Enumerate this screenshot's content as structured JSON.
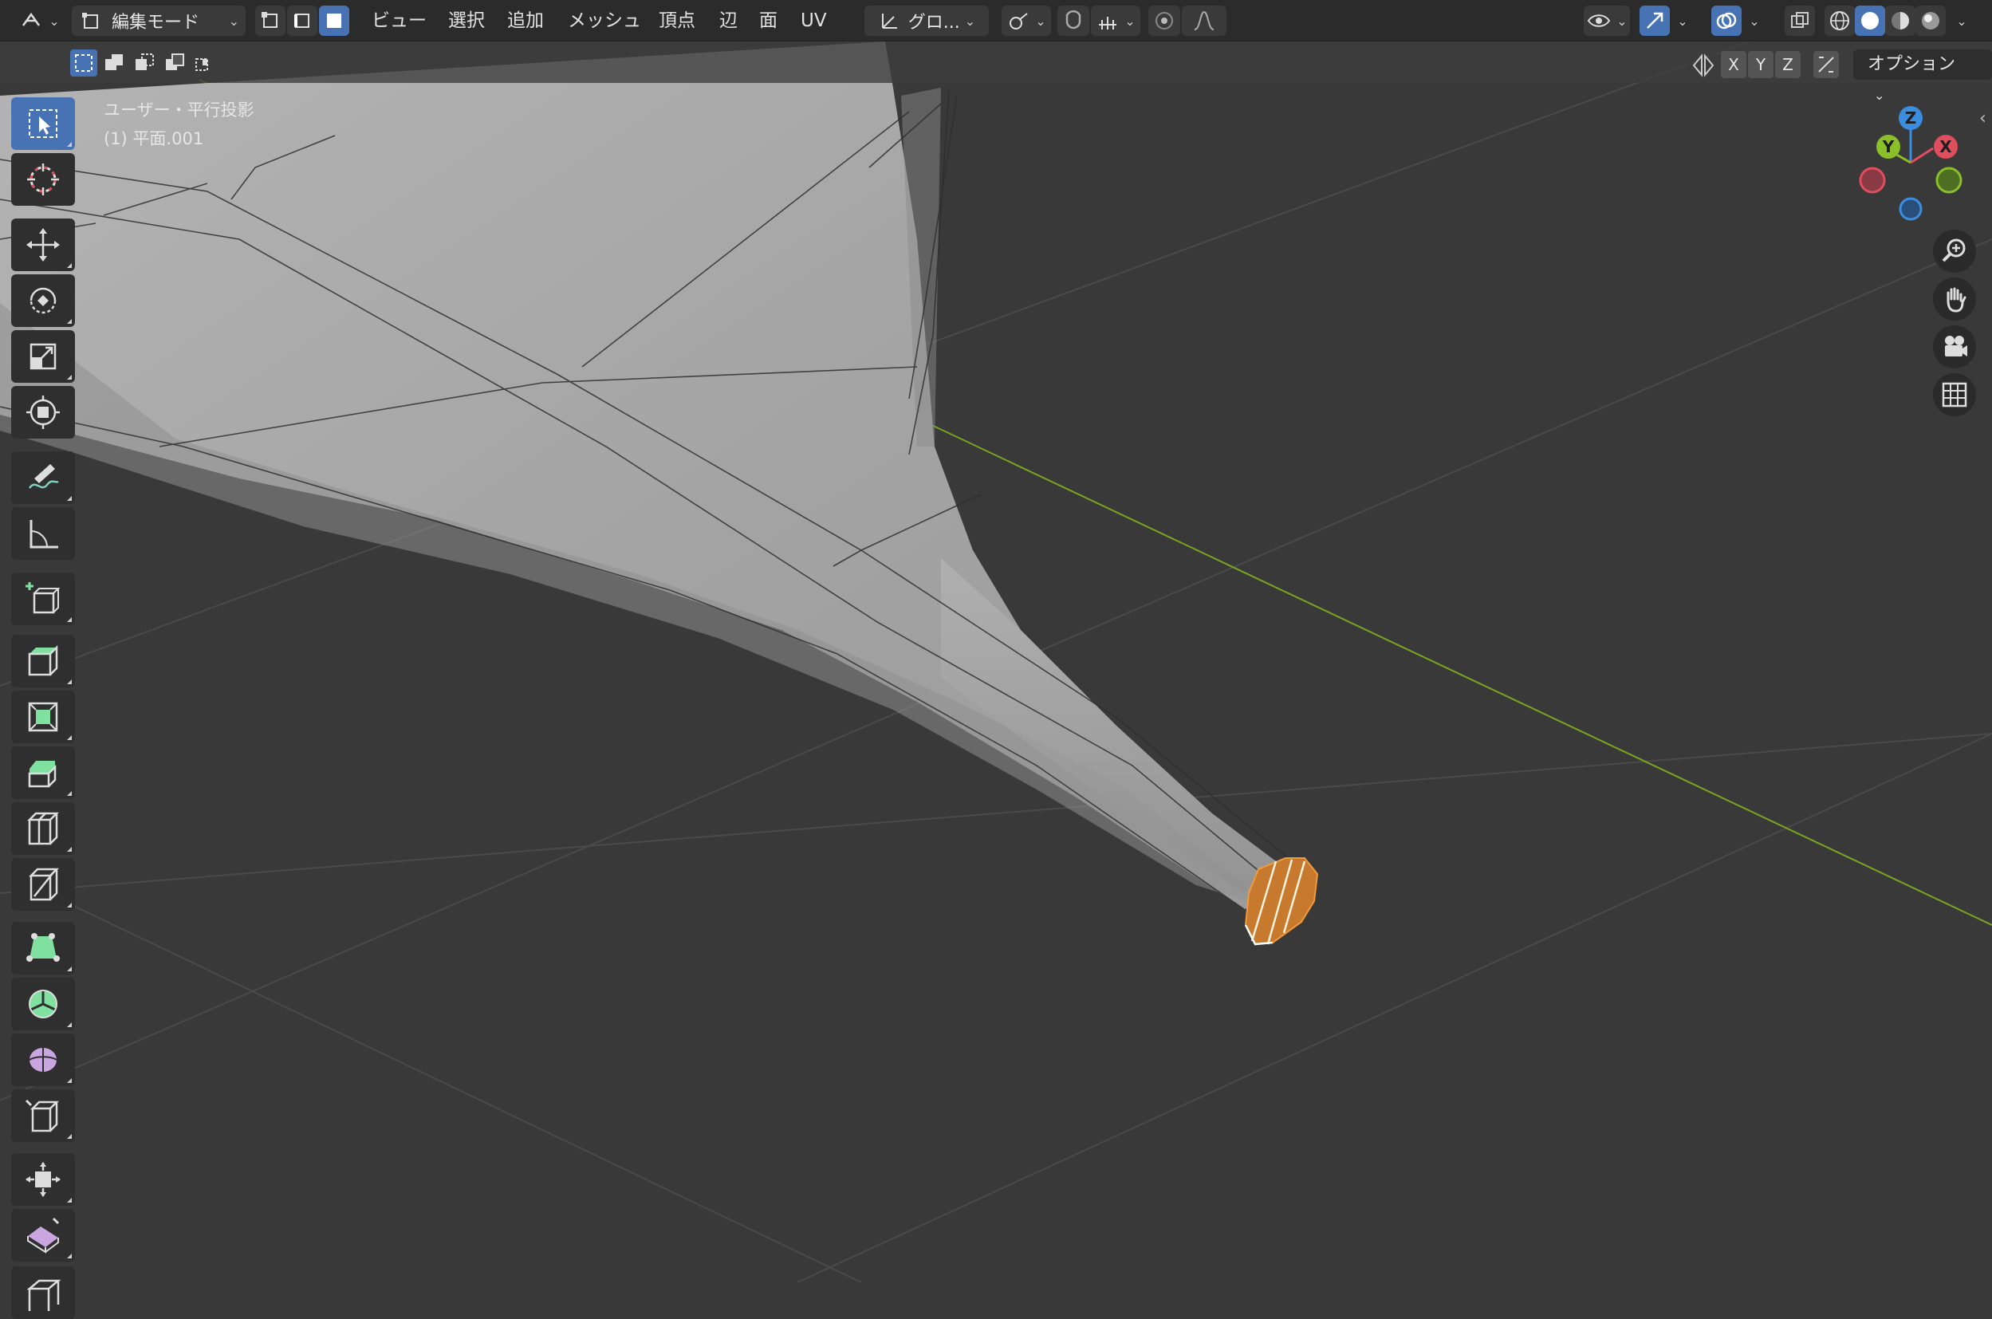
{
  "window": {
    "mode_label": "編集モード"
  },
  "menu": {
    "items": [
      "ビュー",
      "選択",
      "追加",
      "メッシュ",
      "頂点",
      "辺",
      "面",
      "UV"
    ]
  },
  "transform": {
    "orientation_label": "グロ..."
  },
  "viewport": {
    "view_name": "ユーザー・平行投影",
    "object_name": "(1) 平面.001"
  },
  "mirror_axes": [
    "X",
    "Y",
    "Z"
  ],
  "options_label": "オプション",
  "gizmo": {
    "x_label": "X",
    "y_label": "Y",
    "z_label": "Z"
  },
  "colors": {
    "accent": "#4772b3",
    "header_bg": "#2b2b2b",
    "viewport_bg": "#393939",
    "mesh": "#a9a9a9",
    "selection": "#e08a32",
    "grid_y_axis": "#7aa521",
    "axis_x": "#e04e5e",
    "axis_y": "#8bbf2a",
    "axis_z": "#3b8de0"
  },
  "toolbar": {
    "tools": [
      "select-box-icon",
      "cursor-icon",
      "move-icon",
      "rotate-icon",
      "scale-icon",
      "transform-icon",
      "annotate-icon",
      "measure-icon",
      "add-cube-icon",
      "extrude-region-icon",
      "inset-faces-icon",
      "bevel-icon",
      "loop-cut-icon",
      "knife-icon",
      "poly-build-icon",
      "spin-icon",
      "smooth-icon",
      "edge-slide-icon",
      "shrink-fatten-icon",
      "shear-icon",
      "rip-region-icon"
    ],
    "active_tool": "select-box-icon"
  },
  "nav": [
    "zoom-icon",
    "hand-icon",
    "camera-icon",
    "grid-icon"
  ]
}
